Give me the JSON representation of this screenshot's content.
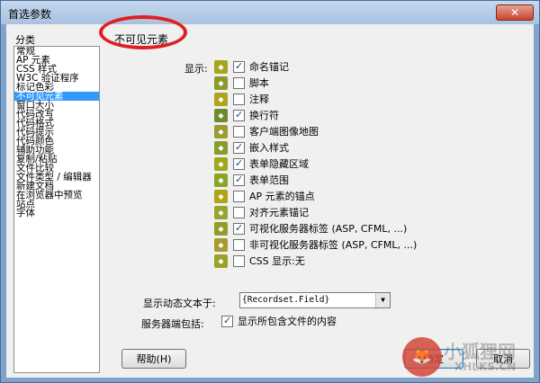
{
  "window": {
    "title": "首选参数",
    "close_label": "✕"
  },
  "sidebar": {
    "label": "分类",
    "items": [
      "常规",
      "AP 元素",
      "CSS 样式",
      "W3C 验证程序",
      "标记色彩",
      "不可见元素",
      "窗口大小",
      "代码改写",
      "代码格式",
      "代码提示",
      "代码颜色",
      "辅助功能",
      "复制/粘贴",
      "文件比较",
      "文件类型 / 编辑器",
      "新建文档",
      "在浏览器中预览",
      "站点",
      "字体"
    ],
    "selected": "不可见元素"
  },
  "page": {
    "title": "不可见元素",
    "show_label": "显示:"
  },
  "options": [
    {
      "label": "命名锚记",
      "checked": true,
      "icon": "anchor-icon",
      "color": "#a6a61c"
    },
    {
      "label": "脚本",
      "checked": false,
      "icon": "script-icon",
      "color": "#8a9b2a"
    },
    {
      "label": "注释",
      "checked": false,
      "icon": "comment-icon",
      "color": "#b1a21f"
    },
    {
      "label": "换行符",
      "checked": true,
      "icon": "line-break-icon",
      "color": "#6e8a2e"
    },
    {
      "label": "客户端图像地图",
      "checked": false,
      "icon": "image-map-icon",
      "color": "#9c9a34"
    },
    {
      "label": "嵌入样式",
      "checked": true,
      "icon": "embedded-style-icon",
      "color": "#889c2b"
    },
    {
      "label": "表单隐藏区域",
      "checked": true,
      "icon": "hidden-field-icon",
      "color": "#a2a81e"
    },
    {
      "label": "表单范围",
      "checked": true,
      "icon": "form-scope-icon",
      "color": "#8aa526"
    },
    {
      "label": "AP 元素的锚点",
      "checked": false,
      "icon": "ap-anchor-icon",
      "color": "#b2a316"
    },
    {
      "label": "对齐元素锚记",
      "checked": false,
      "icon": "align-anchor-icon",
      "color": "#97a52d"
    },
    {
      "label": "可视化服务器标签 (ASP, CFML, ...)",
      "checked": true,
      "icon": "visual-server-tag-icon",
      "color": "#8f9e29"
    },
    {
      "label": "非可视化服务器标签 (ASP, CFML, ...)",
      "checked": false,
      "icon": "nonvisual-server-tag-icon",
      "color": "#a89b2a"
    },
    {
      "label": "CSS 显示:无",
      "checked": false,
      "icon": "css-display-none-icon",
      "color": "#9aa128"
    }
  ],
  "dynamic_text": {
    "label": "显示动态文本于:",
    "value": "{Recordset.Field}"
  },
  "server_include": {
    "label": "服务器端包括:",
    "option_label": "显示所包含文件的内容",
    "checked": true
  },
  "buttons": {
    "help": "帮助(H)",
    "ok": "确定",
    "cancel": "取消"
  },
  "watermark": {
    "cn": "小狐狸网",
    "en": "XHLKS.CN"
  }
}
